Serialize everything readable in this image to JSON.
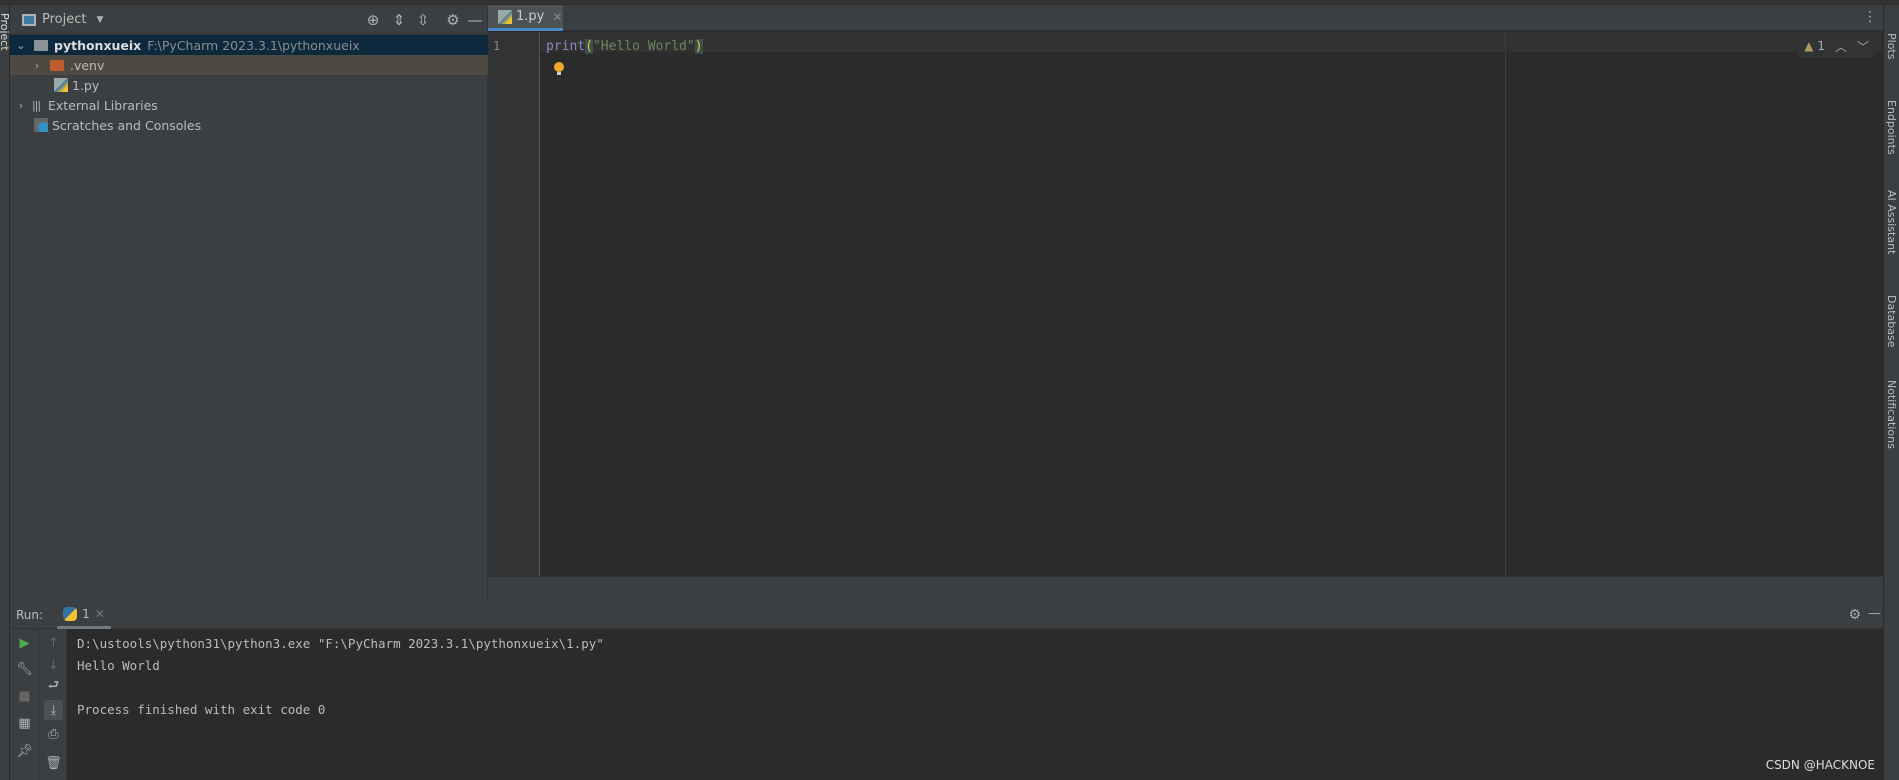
{
  "left_stripe": {
    "label": "Project"
  },
  "project": {
    "title": "Project",
    "tree": [
      {
        "label": "pythonxueix",
        "path": "F:\\PyCharm 2023.3.1\\pythonxueix"
      },
      {
        "label": ".venv"
      },
      {
        "label": "1.py"
      },
      {
        "label": "External Libraries"
      },
      {
        "label": "Scratches and Consoles"
      }
    ]
  },
  "editor": {
    "tab": "1.py",
    "line_number": "1",
    "code": {
      "fn": "print",
      "open": "(",
      "str": "\"Hello World\"",
      "close": ")"
    },
    "warning_count": "1"
  },
  "right_stripe": [
    "Plots",
    "Endpoints",
    "AI Assistant",
    "Database",
    "Notifications"
  ],
  "run": {
    "label": "Run:",
    "tab": "1",
    "console": [
      "D:\\ustools\\python31\\python3.exe \"F:\\PyCharm 2023.3.1\\pythonxueix\\1.py\"",
      "Hello World",
      "",
      "Process finished with exit code 0"
    ]
  },
  "watermark": "CSDN @HACKNOE",
  "colors": {
    "accent": "#4a88c7",
    "selected_row": "#0d293e",
    "venv_folder": "#c05d2c"
  }
}
